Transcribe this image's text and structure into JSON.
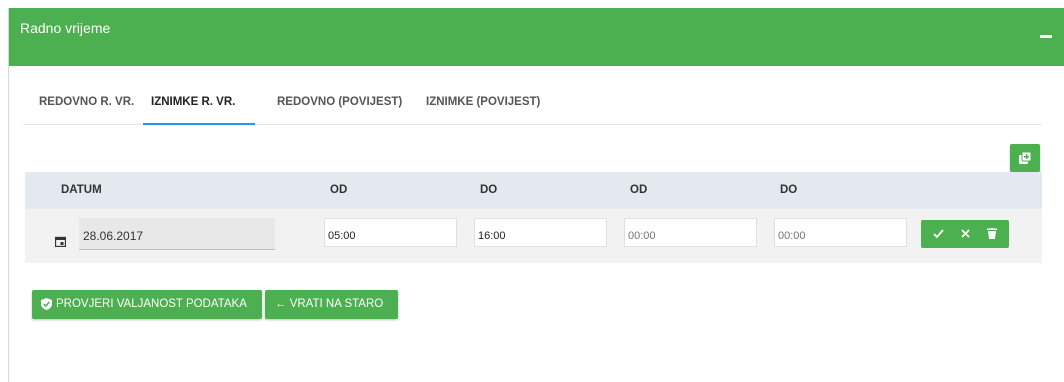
{
  "panel": {
    "title": "Radno vrijeme"
  },
  "tabs": [
    {
      "label": "REDOVNO R. VR."
    },
    {
      "label": "IZNIMKE R. VR."
    },
    {
      "label": "REDOVNO (POVIJEST)"
    },
    {
      "label": "IZNIMKE (POVIJEST)"
    }
  ],
  "active_tab_index": 1,
  "table": {
    "headers": [
      "DATUM",
      "OD",
      "DO",
      "OD",
      "DO"
    ],
    "rows": [
      {
        "date": "28.06.2017",
        "od1": "05:00",
        "do1": "16:00",
        "od2_placeholder": "00:00",
        "do2_placeholder": "00:00"
      }
    ]
  },
  "buttons": {
    "validate": "PROVJERI VALJANOST PODATAKA",
    "revert": "← VRATI NA STARO"
  },
  "icons": {
    "collapse": "minus-icon",
    "add": "copy-add-icon",
    "calendar": "calendar-icon",
    "confirm": "check-icon",
    "cancel": "close-icon",
    "delete": "trash-icon",
    "validate": "shield-check-icon"
  },
  "colors": {
    "header": "#4caf50",
    "accent_tab": "#2196f3",
    "table_head": "#e3e9ef"
  }
}
